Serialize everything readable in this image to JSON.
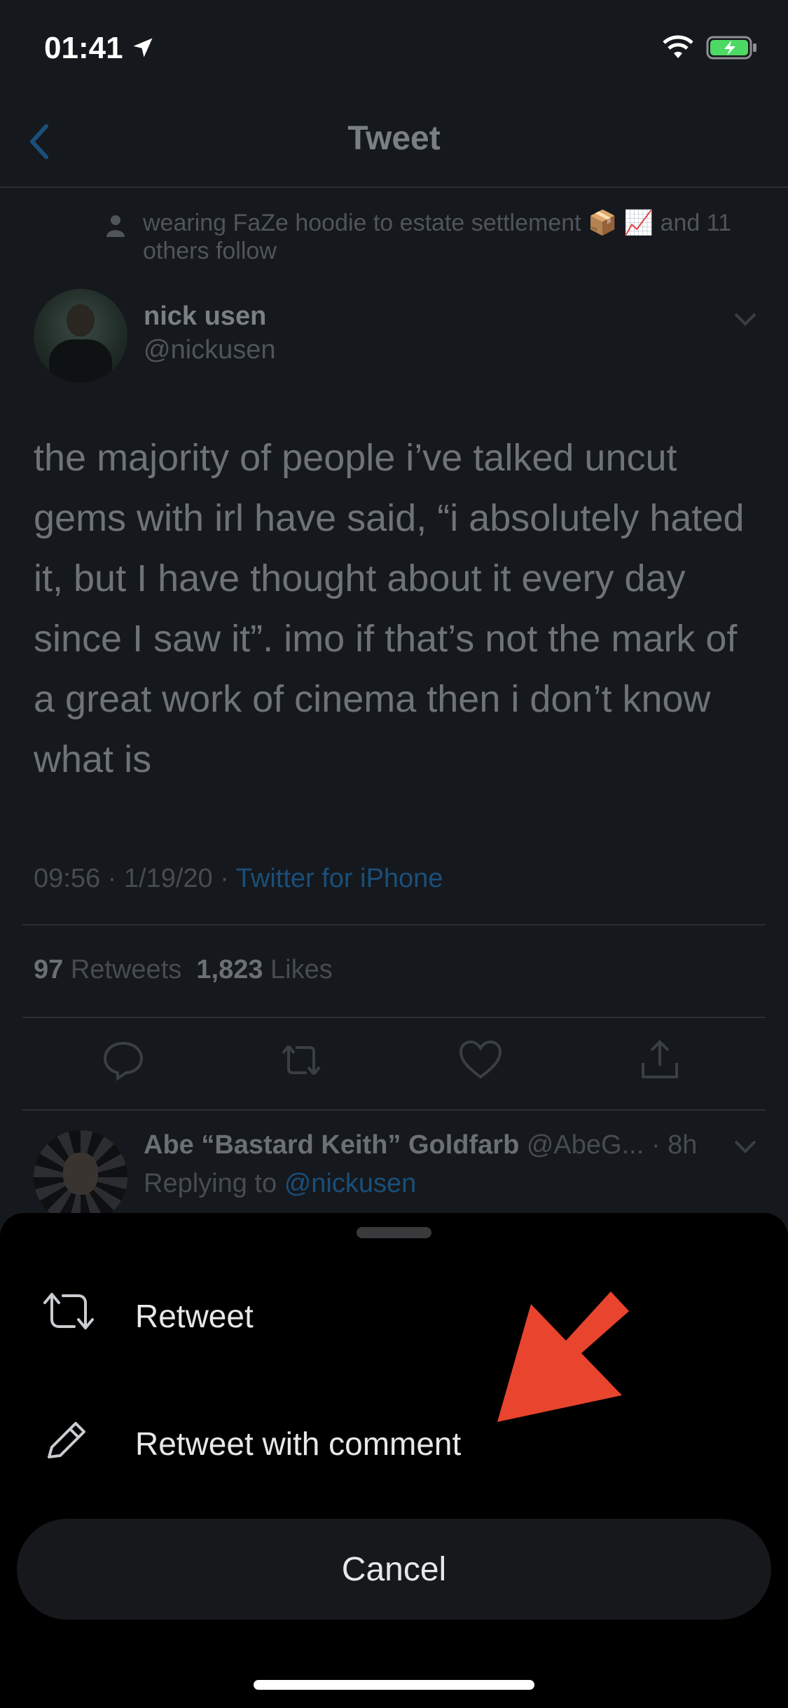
{
  "status_bar": {
    "time": "01:41"
  },
  "nav": {
    "title": "Tweet"
  },
  "tweet": {
    "social_context": "wearing FaZe hoodie to estate settlement 📦 📈 and 11 others follow",
    "author_name": "nick usen",
    "author_handle": "@nickusen",
    "text": "the majority of people i’ve talked uncut gems with irl have said, “i absolutely hated it, but I have thought about it every day since I saw it”. imo if that’s not the mark of a great work of cinema then i don’t know what is",
    "time": "09:56",
    "date": "1/19/20",
    "source": "Twitter for iPhone",
    "retweets_count": "97",
    "retweets_label": "Retweets",
    "likes_count": "1,823",
    "likes_label": "Likes"
  },
  "reply": {
    "name": "Abe “Bastard Keith” Goldfarb",
    "handle": "@AbeG...",
    "age": "8h",
    "replying_prefix": "Replying to",
    "replying_mention": "@nickusen"
  },
  "sheet": {
    "options": [
      {
        "label": "Retweet",
        "icon": "retweet-icon"
      },
      {
        "label": "Retweet with comment",
        "icon": "pencil-icon"
      }
    ],
    "cancel_label": "Cancel"
  },
  "colors": {
    "accent": "#1da1f2",
    "annotation_arrow": "#e8442e",
    "sheet_bg": "#000000"
  }
}
